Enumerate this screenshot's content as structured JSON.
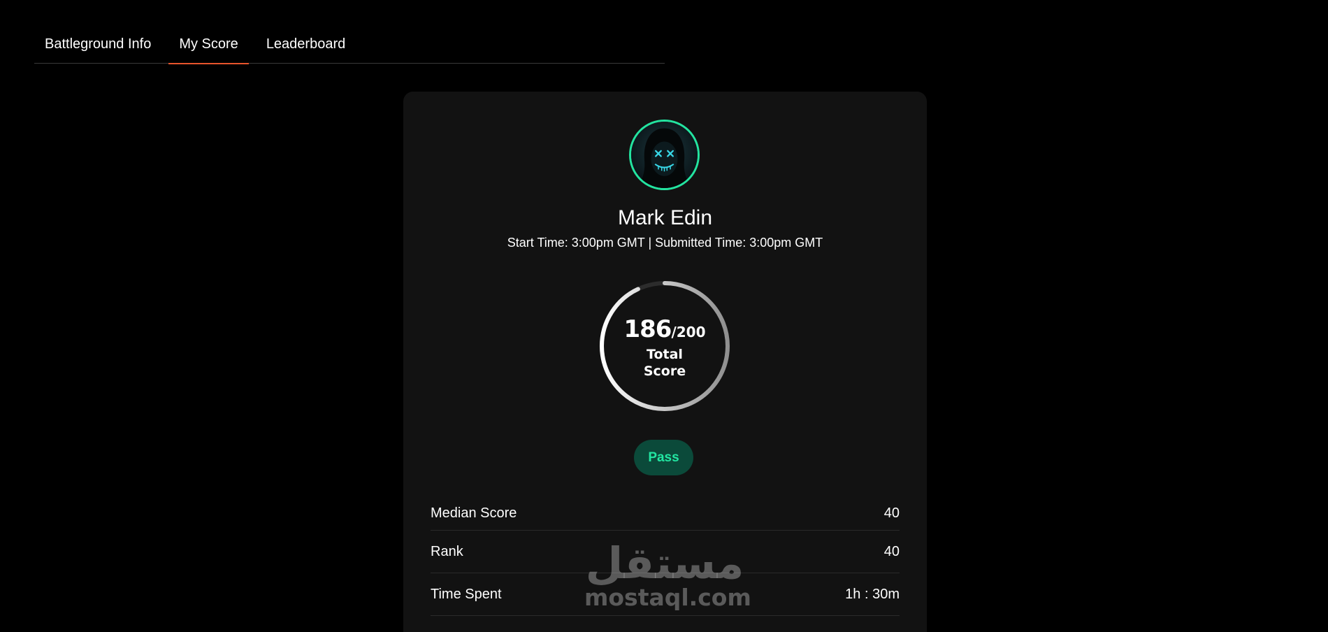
{
  "tabs": [
    {
      "label": "Battleground Info",
      "active": false
    },
    {
      "label": "My Score",
      "active": true
    },
    {
      "label": "Leaderboard",
      "active": false
    }
  ],
  "colors": {
    "tab_indicator": "#e8542c",
    "avatar_ring": "#23e4a0",
    "pass_text": "#22e6a2",
    "pass_bg": "#0b4a3a",
    "card_bg": "#121212"
  },
  "profile": {
    "name": "Mark Edin",
    "times": "Start Time: 3:00pm GMT | Submitted Time: 3:00pm GMT",
    "avatar_icon": "masked-hacker-avatar"
  },
  "score": {
    "value": "186",
    "denominator": "/200",
    "label_line1": "Total",
    "label_line2": "Score",
    "fraction": 0.93
  },
  "status": {
    "label": "Pass"
  },
  "stats": [
    {
      "label": "Median Score",
      "value": "40"
    },
    {
      "label": "Rank",
      "value": "40"
    },
    {
      "label": "Time Spent",
      "value": "1h : 30m"
    }
  ],
  "watermark": {
    "arabic": "مستقل",
    "latin": "mostaql.com"
  }
}
